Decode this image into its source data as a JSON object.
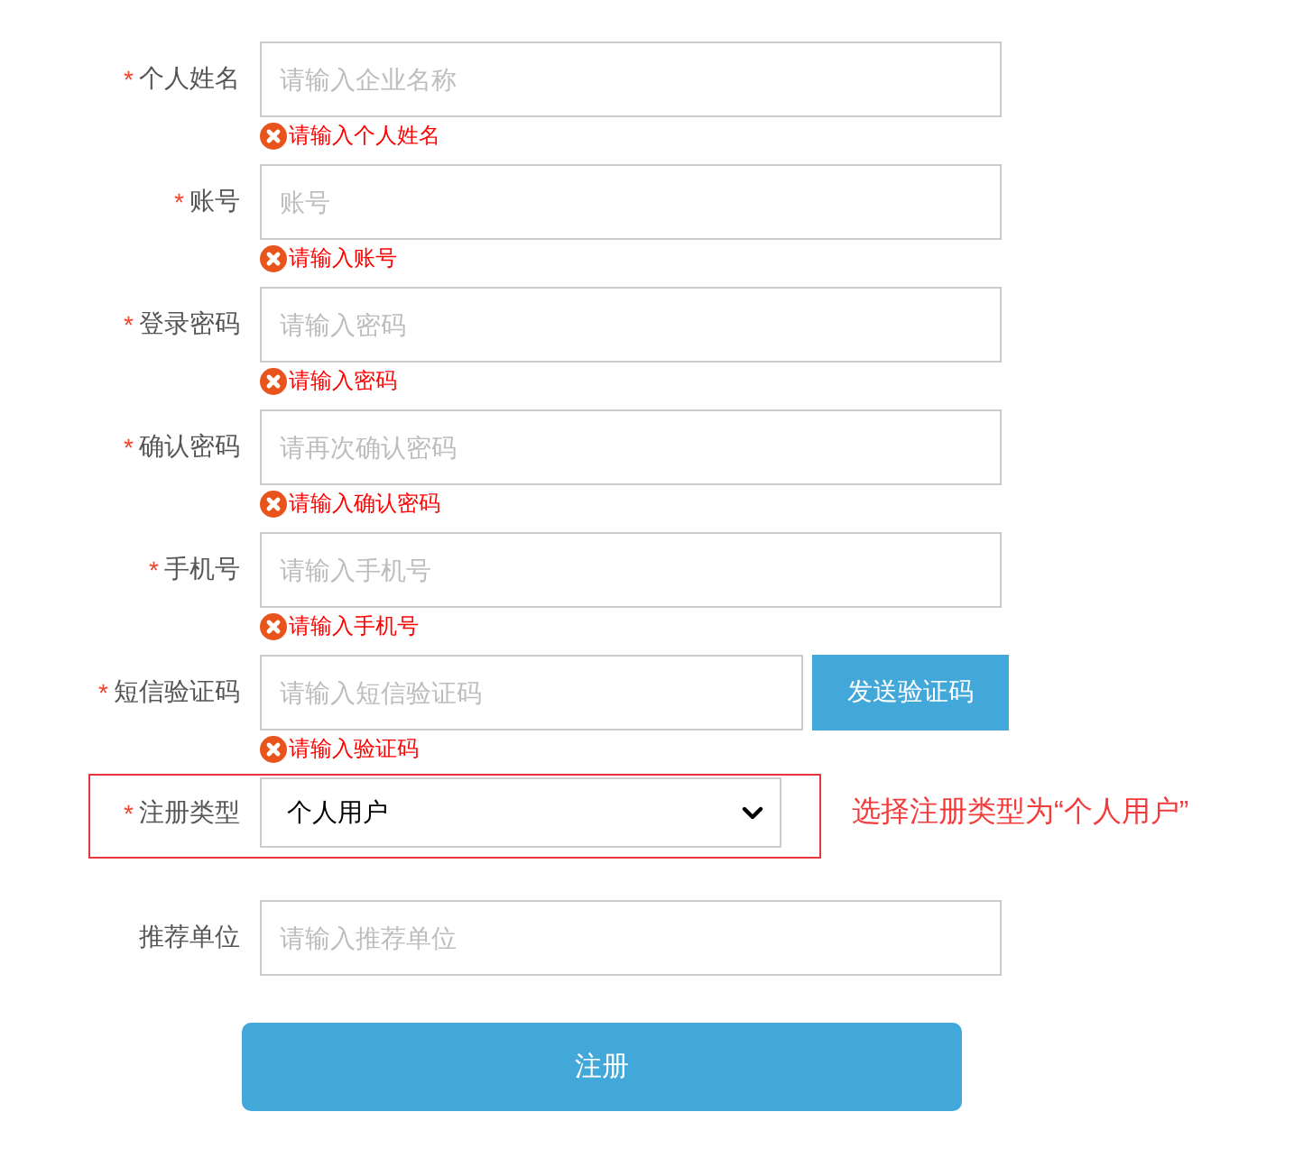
{
  "fields": [
    {
      "kind": "input",
      "required_mark": "*",
      "label": "个人姓名",
      "placeholder": "请输入企业名称",
      "error": "请输入个人姓名"
    },
    {
      "kind": "input",
      "required_mark": "*",
      "label": "账号",
      "placeholder": "账号",
      "error": "请输入账号"
    },
    {
      "kind": "input",
      "required_mark": "*",
      "label": "登录密码",
      "placeholder": "请输入密码",
      "error": "请输入密码"
    },
    {
      "kind": "input",
      "required_mark": "*",
      "label": "确认密码",
      "placeholder": "请再次确认密码",
      "error": "请输入确认密码"
    },
    {
      "kind": "input",
      "required_mark": "*",
      "label": "手机号",
      "placeholder": "请输入手机号",
      "error": "请输入手机号"
    },
    {
      "kind": "input_with_button",
      "required_mark": "*",
      "label": "短信验证码",
      "placeholder": "请输入短信验证码",
      "button": "发送验证码",
      "error": "请输入验证码"
    },
    {
      "kind": "select",
      "required_mark": "*",
      "label": "注册类型",
      "value": "个人用户",
      "highlighted": true,
      "annotation": "选择注册类型为“个人用户”"
    },
    {
      "kind": "input",
      "label": "推荐单位",
      "placeholder": "请输入推荐单位"
    }
  ],
  "submit": "注册"
}
